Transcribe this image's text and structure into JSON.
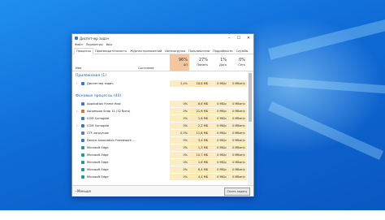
{
  "window": {
    "title": "Диспетчер задач",
    "controls": [
      "–",
      "☐",
      "✕"
    ]
  },
  "menu": [
    "Файл",
    "Параметры",
    "Вид"
  ],
  "tabs": [
    "Процессы",
    "Производительность",
    "Журнал приложений",
    "Автозагрузка",
    "Пользователи",
    "Подробности",
    "Службы"
  ],
  "columns": {
    "name": "Имя",
    "state": "Состояние",
    "cpu": {
      "pct": "96%",
      "label": "ЦП"
    },
    "mem": {
      "pct": "27%",
      "label": "Память"
    },
    "disk": {
      "pct": "1%",
      "label": "Диск"
    },
    "net": {
      "pct": "0%",
      "label": "Сеть"
    }
  },
  "sections": {
    "apps": "Приложения (1)",
    "background": "Фоновые процессы (40)"
  },
  "rows": [
    {
      "name": "Диспетчер задач",
      "cpu": "2,4%",
      "mem": "18,6 МБ",
      "disk": "0 МБ/с",
      "net": "0 Мбит/с",
      "icon_color": "#2b7bd1",
      "expand": true
    },
    {
      "name": "Application Frame Host",
      "cpu": "0%",
      "mem": "8,6 МБ",
      "disk": "0 МБ/с",
      "net": "0 Мбит/с",
      "icon_color": "#3a78c8",
      "expand": false
    },
    {
      "name": "Ashampoo Snap 11 (32 бита)",
      "cpu": "0%",
      "mem": "21,6 МБ",
      "disk": "0 МБ/с",
      "net": "0 Мбит/с",
      "icon_color": "#e0702a",
      "expand": true
    },
    {
      "name": "COM Surrogate",
      "cpu": "0%",
      "mem": "1,6 МБ",
      "disk": "0 МБ/с",
      "net": "0 Мбит/с",
      "icon_color": "#3a78c8",
      "expand": false
    },
    {
      "name": "COM Surrogate",
      "cpu": "0%",
      "mem": "2,2 МБ",
      "disk": "0 МБ/с",
      "net": "0 Мбит/с",
      "icon_color": "#3a78c8",
      "expand": true
    },
    {
      "name": "CTF-загрузчик",
      "cpu": "0,3%",
      "mem": "11,8 МБ",
      "disk": "0 МБ/с",
      "net": "0 Мбит/с",
      "icon_color": "#5a7ea8",
      "expand": false
    },
    {
      "name": "Device Association Framework ...",
      "cpu": "0%",
      "mem": "3,4 МБ",
      "disk": "0 МБ/с",
      "net": "0 Мбит/с",
      "icon_color": "#3a78c8",
      "expand": false
    },
    {
      "name": "Microsoft Edge",
      "cpu": "0%",
      "mem": "1,3 МБ",
      "disk": "0 МБ/с",
      "net": "0 Мбит/с",
      "icon_color": "#1b9d9a",
      "expand": false
    },
    {
      "name": "Microsoft Edge",
      "cpu": "0%",
      "mem": "10,7 МБ",
      "disk": "0 МБ/с",
      "net": "0 Мбит/с",
      "icon_color": "#1b9d9a",
      "expand": false
    },
    {
      "name": "Microsoft Edge",
      "cpu": "0%",
      "mem": "1,8 МБ",
      "disk": "0 МБ/с",
      "net": "0 Мбит/с",
      "icon_color": "#1b9d9a",
      "expand": false
    },
    {
      "name": "Microsoft Edge",
      "cpu": "0%",
      "mem": "6,4 МБ",
      "disk": "0 МБ/с",
      "net": "0 Мбит/с",
      "icon_color": "#1b9d9a",
      "expand": false
    },
    {
      "name": "Microsoft Edge",
      "cpu": "0%",
      "mem": "4,4 МБ",
      "disk": "0 МБ/с",
      "net": "0 Мбит/с",
      "icon_color": "#1b9d9a",
      "expand": false
    }
  ],
  "footer": {
    "less": "Меньше",
    "end_task": "Снять задачу"
  }
}
